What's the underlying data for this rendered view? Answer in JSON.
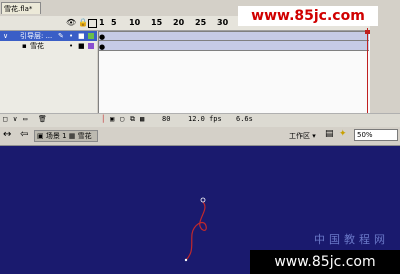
{
  "document": {
    "tab_label": "雪花.fla*"
  },
  "timeline": {
    "frame_numbers": [
      "1",
      "5",
      "10",
      "15",
      "20",
      "25",
      "30"
    ],
    "layers": [
      {
        "name": "引导层: ..."
      },
      {
        "name": "雪花"
      }
    ],
    "status": {
      "current_frame": "80",
      "fps": "12.0 fps",
      "seconds": "6.6s"
    }
  },
  "edit_bar": {
    "scene_label": "场景 1",
    "symbol_label": "雪花",
    "workspace_label": "工作区",
    "zoom_value": "50%"
  },
  "watermarks": {
    "top": "www.85jc.com",
    "bottom": "www.85jc.com",
    "chinese": "中国教程网"
  },
  "colors": {
    "stage": "#1a1a6e",
    "guide_path": "#c0282c",
    "layer_selected": "#3a5ec6",
    "playhead": "#c02020"
  }
}
